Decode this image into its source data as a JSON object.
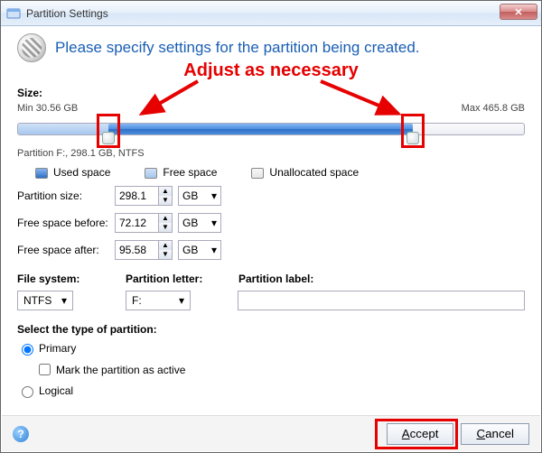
{
  "window": {
    "title": "Partition Settings",
    "close_glyph": "✕"
  },
  "header": {
    "title": "Please specify settings for the partition being created."
  },
  "annotation": {
    "adjust": "Adjust as necessary"
  },
  "size": {
    "label": "Size:",
    "min": "Min 30.56 GB",
    "max": "Max 465.8 GB",
    "before_pct": 18,
    "fill_end_pct": 78,
    "caption": "Partition F:, 298.1 GB, NTFS"
  },
  "legend": {
    "used": "Used space",
    "free": "Free space",
    "unalloc": "Unallocated space"
  },
  "fields": {
    "partition_size": {
      "label": "Partition size:",
      "value": "298.1",
      "unit": "GB"
    },
    "free_before": {
      "label": "Free space before:",
      "value": "72.12",
      "unit": "GB"
    },
    "free_after": {
      "label": "Free space after:",
      "value": "95.58",
      "unit": "GB"
    }
  },
  "filesystem": {
    "fs_label": "File system:",
    "fs_value": "NTFS",
    "letter_label": "Partition letter:",
    "letter_value": "F:",
    "plabel_label": "Partition label:",
    "plabel_value": ""
  },
  "type": {
    "section": "Select the type of partition:",
    "primary": "Primary",
    "mark_active": "Mark the partition as active",
    "logical": "Logical",
    "primary_checked": true,
    "active_checked": false,
    "logical_checked": false
  },
  "buttons": {
    "help": "?",
    "accept_u": "A",
    "accept_rest": "ccept",
    "cancel_u": "C",
    "cancel_rest": "ancel"
  },
  "dropdown_glyph": "▾",
  "spin_up": "▲",
  "spin_down": "▼"
}
